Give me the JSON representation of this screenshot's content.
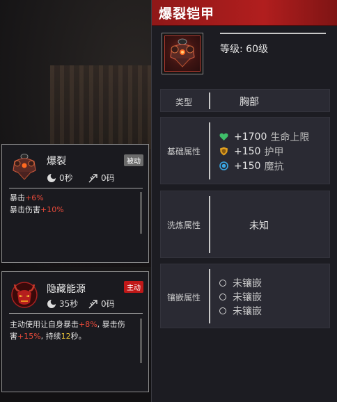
{
  "item": {
    "title": "爆裂铠甲",
    "icon": "chest-armor-icon",
    "level_label": "等级: 60级",
    "type_label": "类型",
    "type_value": "胸部",
    "base_label": "基础属性",
    "base_stats": [
      {
        "icon": "heart-icon",
        "color": "#3fbf6a",
        "value": "+1700",
        "name": "生命上限"
      },
      {
        "icon": "shield-icon",
        "color": "#e0a020",
        "value": "+150",
        "name": "护甲"
      },
      {
        "icon": "magic-resist-icon",
        "color": "#3aa8e6",
        "value": "+150",
        "name": "魔抗"
      }
    ],
    "refine_label": "洗炼属性",
    "refine_value": "未知",
    "socket_label": "镶嵌属性",
    "sockets": [
      "未镶嵌",
      "未镶嵌",
      "未镶嵌"
    ]
  },
  "skills": [
    {
      "name": "爆裂",
      "badge": "被动",
      "cooldown": "0秒",
      "cost": "0码",
      "lines": [
        {
          "prefix": "暴击",
          "value": "+6%"
        },
        {
          "prefix": "暴击伤害",
          "value": "+10%"
        }
      ]
    },
    {
      "name": "隐藏能源",
      "badge": "主动",
      "cooldown": "35秒",
      "cost": "0码",
      "desc": {
        "p1": "主动使用让自身暴击",
        "v1": "+8%",
        "p2": ", 暴击伤",
        "p3": "害",
        "v2": "+15%",
        "p4": ", 持续",
        "v3": "12",
        "p5": "秒。"
      }
    }
  ]
}
